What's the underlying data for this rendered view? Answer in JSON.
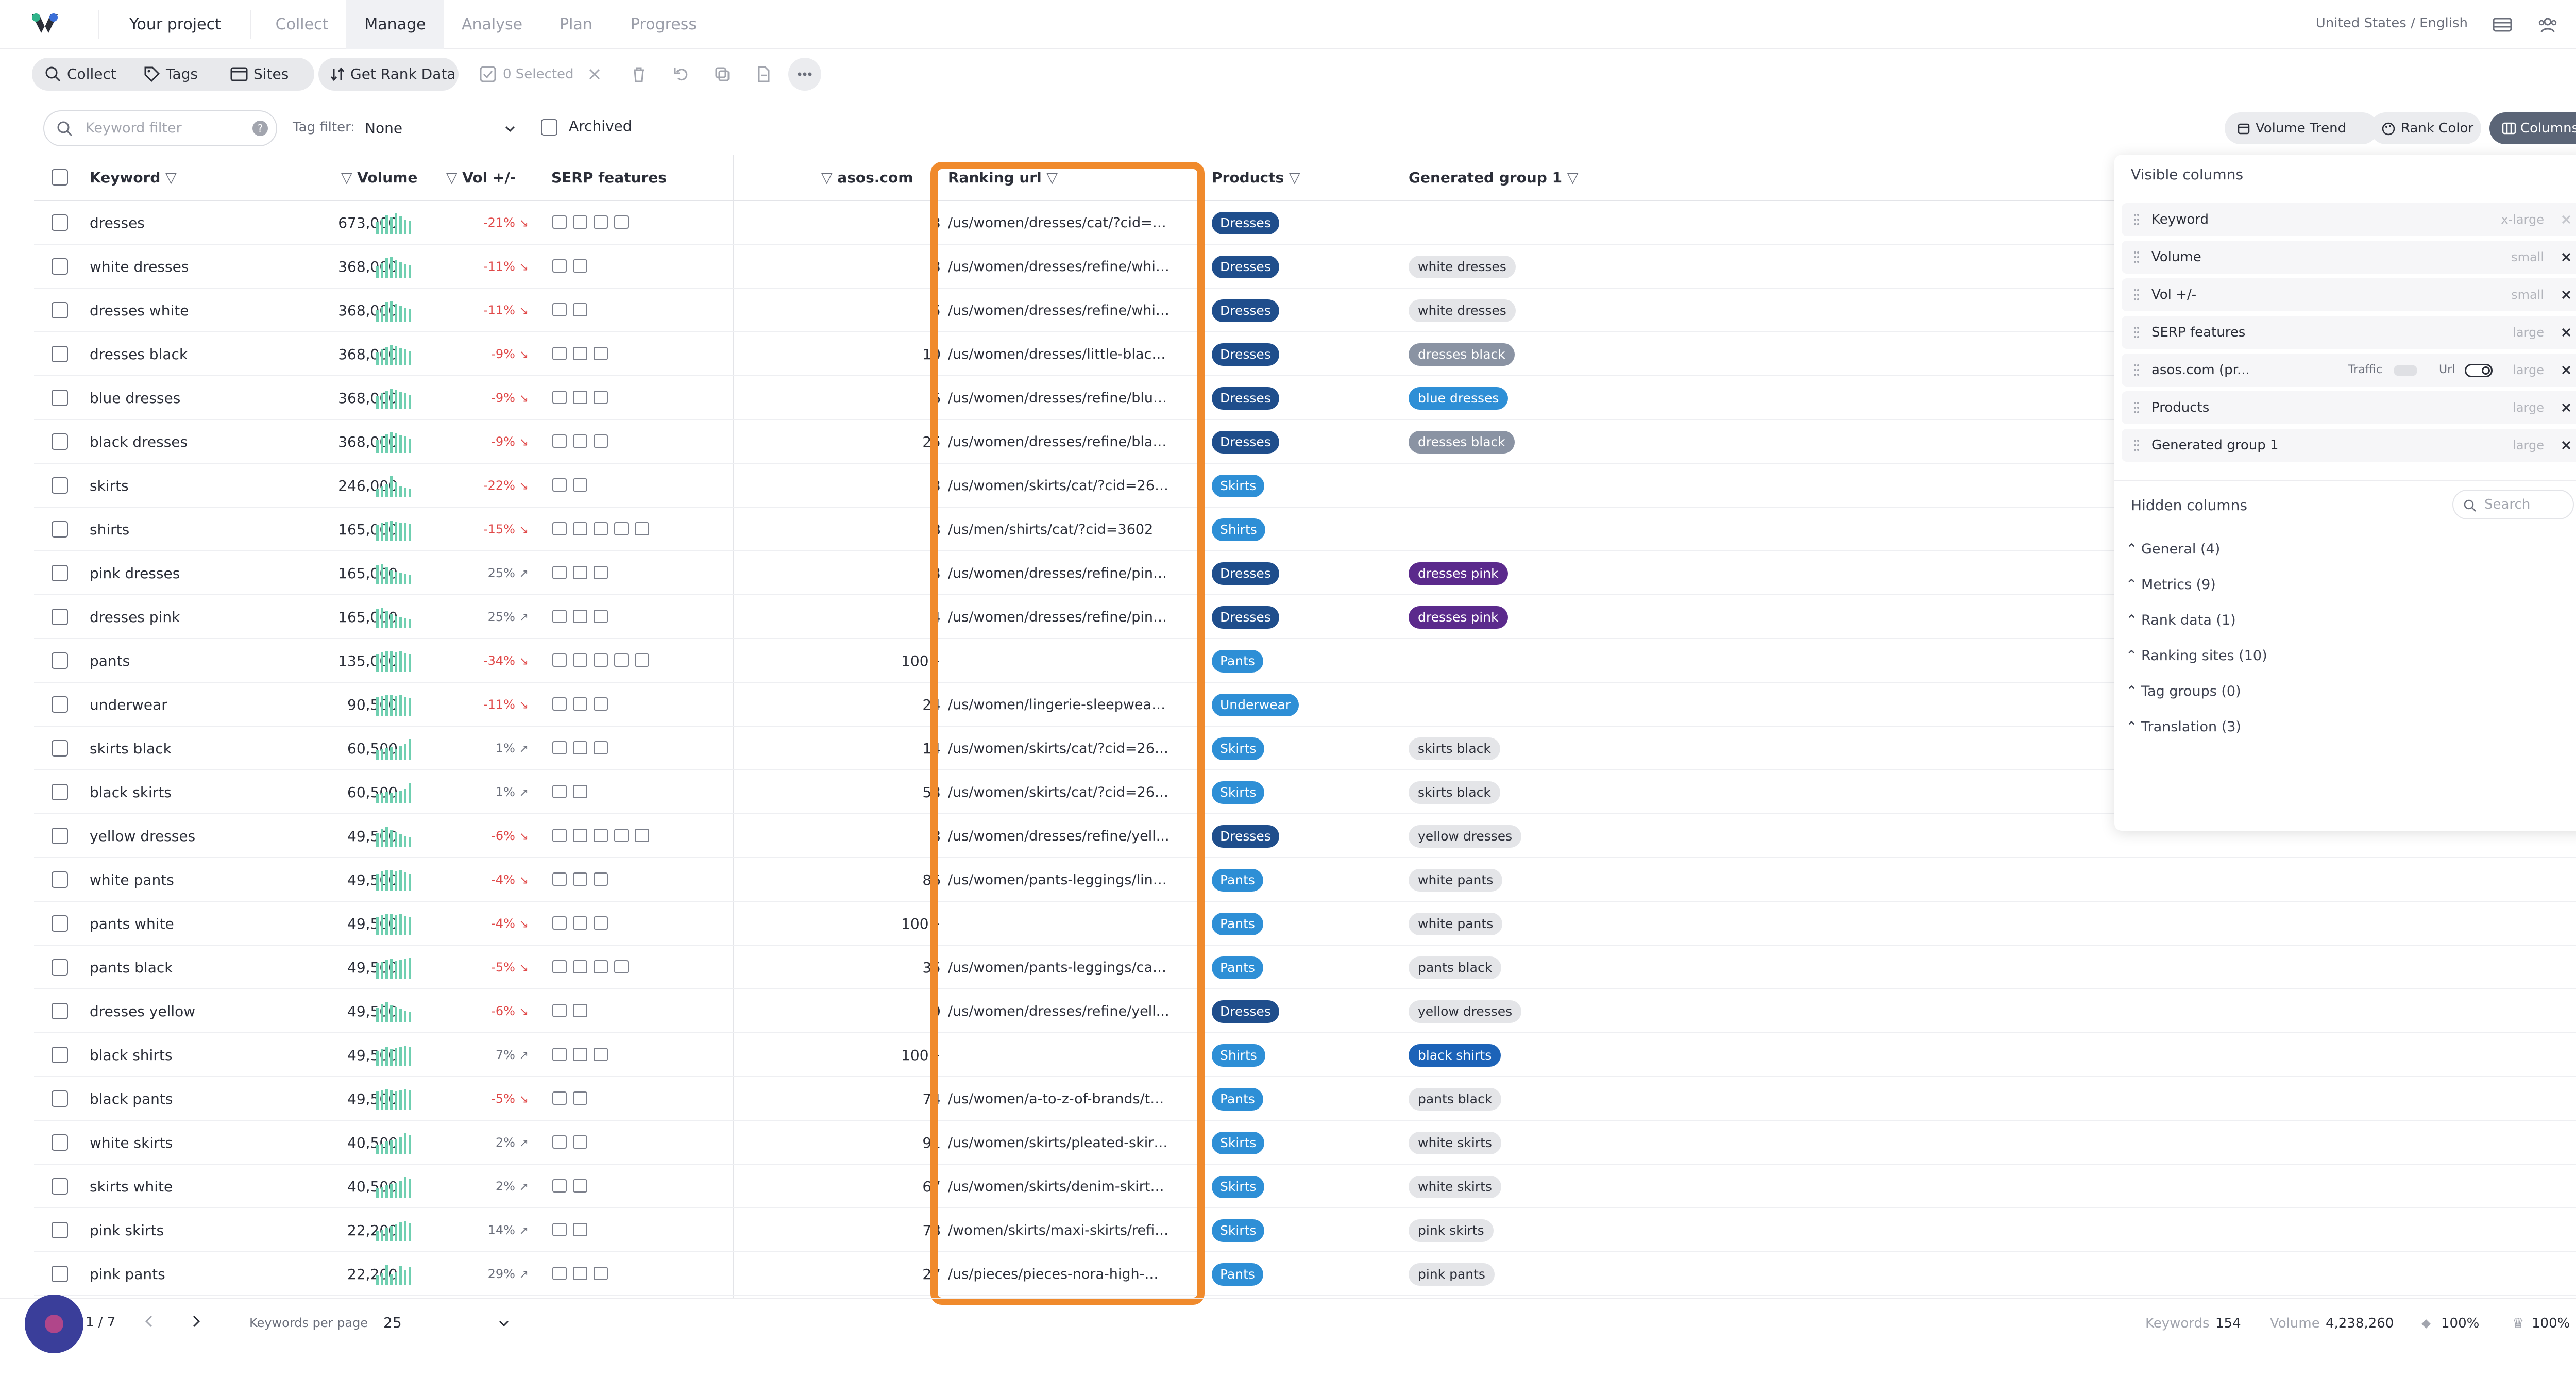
{
  "nav": {
    "project": "Your project",
    "tabs": [
      "Collect",
      "Manage",
      "Analyse",
      "Plan",
      "Progress"
    ],
    "active_tab": "Manage",
    "locale": "United States / English"
  },
  "toolbar": {
    "collect": "Collect",
    "tags": "Tags",
    "sites": "Sites",
    "get_rank": "Get Rank Data",
    "selected": "0 Selected"
  },
  "filters": {
    "keyword_placeholder": "Keyword filter",
    "help": "?",
    "tag_filter_label": "Tag filter:",
    "tag_filter_value": "None",
    "archived": "Archived",
    "volume_trend": "Volume Trend",
    "rank_color": "Rank Color",
    "columns": "Columns"
  },
  "headers": {
    "keyword": "Keyword",
    "volume": "Volume",
    "vol_change": "Vol +/-",
    "serp": "SERP features",
    "site": "asos.com",
    "ranking_url": "Ranking url",
    "products": "Products",
    "group": "Generated group 1"
  },
  "colors": {
    "dresses": "#1f4e8c",
    "skirts": "#2e8fd6",
    "shirts": "#2e8fd6",
    "pants": "#2e8fd6",
    "underwear": "#2e8fd6",
    "highlight": "#f08a2c"
  },
  "rows": [
    {
      "kw": "dresses",
      "vol": "673,000",
      "chg": "-21%",
      "dir": "down",
      "serp": 4,
      "rank": "3",
      "url": "/us/women/dresses/cat/?cid=8...",
      "prod": "Dresses",
      "group": "",
      "gstyle": "",
      "trend": [
        14,
        20,
        26,
        22,
        30,
        24,
        18,
        15
      ]
    },
    {
      "kw": "white dresses",
      "vol": "368,000",
      "chg": "-11%",
      "dir": "down",
      "serp": 2,
      "rank": "3",
      "url": "/us/women/dresses/refine/whit...",
      "prod": "Dresses",
      "group": "white dresses",
      "gstyle": "grey",
      "trend": [
        12,
        18,
        28,
        30,
        24,
        20,
        16,
        14
      ]
    },
    {
      "kw": "dresses white",
      "vol": "368,000",
      "chg": "-11%",
      "dir": "down",
      "serp": 2,
      "rank": "5",
      "url": "/us/women/dresses/refine/whit...",
      "prod": "Dresses",
      "group": "white dresses",
      "gstyle": "grey",
      "trend": [
        12,
        18,
        28,
        30,
        24,
        20,
        16,
        14
      ]
    },
    {
      "kw": "dresses black",
      "vol": "368,000",
      "chg": "-9%",
      "dir": "down",
      "serp": 3,
      "rank": "10",
      "url": "/us/women/dresses/little-black-...",
      "prod": "Dresses",
      "group": "dresses black",
      "gstyle": "slate",
      "trend": [
        16,
        22,
        26,
        30,
        28,
        24,
        22,
        18
      ]
    },
    {
      "kw": "blue dresses",
      "vol": "368,000",
      "chg": "-9%",
      "dir": "down",
      "serp": 3,
      "rank": "6",
      "url": "/us/women/dresses/refine/blue...",
      "prod": "Dresses",
      "group": "blue dresses",
      "gstyle": "blue",
      "trend": [
        16,
        22,
        26,
        30,
        28,
        24,
        22,
        18
      ]
    },
    {
      "kw": "black dresses",
      "vol": "368,000",
      "chg": "-9%",
      "dir": "down",
      "serp": 3,
      "rank": "25",
      "url": "/us/women/dresses/refine/blac...",
      "prod": "Dresses",
      "group": "dresses black",
      "gstyle": "slate",
      "trend": [
        16,
        22,
        26,
        30,
        28,
        24,
        22,
        18
      ]
    },
    {
      "kw": "skirts",
      "vol": "246,000",
      "chg": "-22%",
      "dir": "down",
      "serp": 2,
      "rank": "3",
      "url": "/us/women/skirts/cat/?cid=2639",
      "prod": "Skirts",
      "group": "",
      "gstyle": "",
      "trend": [
        6,
        10,
        14,
        30,
        18,
        10,
        8,
        6
      ]
    },
    {
      "kw": "shirts",
      "vol": "165,000",
      "chg": "-15%",
      "dir": "down",
      "serp": 5,
      "rank": "8",
      "url": "/us/men/shirts/cat/?cid=3602",
      "prod": "Shirts",
      "group": "",
      "gstyle": "",
      "trend": [
        20,
        24,
        26,
        28,
        26,
        24,
        24,
        22
      ]
    },
    {
      "kw": "pink dresses",
      "vol": "165,000",
      "chg": "25%",
      "dir": "up",
      "serp": 3,
      "rank": "3",
      "url": "/us/women/dresses/refine/pink...",
      "prod": "Dresses",
      "group": "dresses pink",
      "gstyle": "purple",
      "trend": [
        28,
        30,
        24,
        18,
        14,
        12,
        10,
        8
      ]
    },
    {
      "kw": "dresses pink",
      "vol": "165,000",
      "chg": "25%",
      "dir": "up",
      "serp": 3,
      "rank": "4",
      "url": "/us/women/dresses/refine/pink...",
      "prod": "Dresses",
      "group": "dresses pink",
      "gstyle": "purple",
      "trend": [
        28,
        30,
        24,
        18,
        14,
        12,
        10,
        8
      ]
    },
    {
      "kw": "pants",
      "vol": "135,000",
      "chg": "-34%",
      "dir": "down",
      "serp": 5,
      "rank": "100+",
      "url": "",
      "prod": "Pants",
      "group": "",
      "gstyle": "",
      "trend": [
        24,
        28,
        30,
        30,
        28,
        30,
        26,
        24
      ]
    },
    {
      "kw": "underwear",
      "vol": "90,500",
      "chg": "-11%",
      "dir": "down",
      "serp": 3,
      "rank": "24",
      "url": "/us/women/lingerie-sleepwear/...",
      "prod": "Underwear",
      "group": "",
      "gstyle": "",
      "trend": [
        26,
        28,
        30,
        30,
        28,
        30,
        26,
        24
      ]
    },
    {
      "kw": "skirts black",
      "vol": "60,500",
      "chg": "1%",
      "dir": "up",
      "serp": 3,
      "rank": "14",
      "url": "/us/women/skirts/cat/?cid=2639",
      "prod": "Skirts",
      "group": "skirts black",
      "gstyle": "grey",
      "trend": [
        8,
        10,
        12,
        14,
        10,
        16,
        20,
        30
      ]
    },
    {
      "kw": "black skirts",
      "vol": "60,500",
      "chg": "1%",
      "dir": "up",
      "serp": 2,
      "rank": "53",
      "url": "/us/women/skirts/cat/?cid=2639",
      "prod": "Skirts",
      "group": "skirts black",
      "gstyle": "grey",
      "trend": [
        8,
        10,
        12,
        10,
        12,
        14,
        18,
        30
      ]
    },
    {
      "kw": "yellow dresses",
      "vol": "49,500",
      "chg": "-6%",
      "dir": "down",
      "serp": 5,
      "rank": "8",
      "url": "/us/women/dresses/refine/yell...",
      "prod": "Dresses",
      "group": "yellow dresses",
      "gstyle": "grey",
      "trend": [
        18,
        26,
        30,
        24,
        20,
        16,
        12,
        10
      ]
    },
    {
      "kw": "white pants",
      "vol": "49,500",
      "chg": "-4%",
      "dir": "down",
      "serp": 3,
      "rank": "86",
      "url": "/us/women/pants-leggings/line...",
      "prod": "Pants",
      "group": "white pants",
      "gstyle": "grey",
      "trend": [
        24,
        28,
        30,
        30,
        28,
        30,
        26,
        24
      ]
    },
    {
      "kw": "pants white",
      "vol": "49,500",
      "chg": "-4%",
      "dir": "down",
      "serp": 3,
      "rank": "100+",
      "url": "",
      "prod": "Pants",
      "group": "white pants",
      "gstyle": "grey",
      "trend": [
        24,
        28,
        30,
        30,
        28,
        30,
        26,
        24
      ]
    },
    {
      "kw": "pants black",
      "vol": "49,500",
      "chg": "-5%",
      "dir": "down",
      "serp": 4,
      "rank": "35",
      "url": "/us/women/pants-leggings/cat/...",
      "prod": "Pants",
      "group": "pants black",
      "gstyle": "grey",
      "trend": [
        20,
        22,
        26,
        28,
        24,
        26,
        28,
        30
      ]
    },
    {
      "kw": "dresses yellow",
      "vol": "49,500",
      "chg": "-6%",
      "dir": "down",
      "serp": 2,
      "rank": "9",
      "url": "/us/women/dresses/refine/yell...",
      "prod": "Dresses",
      "group": "yellow dresses",
      "gstyle": "grey",
      "trend": [
        18,
        26,
        30,
        24,
        20,
        16,
        12,
        10
      ]
    },
    {
      "kw": "black shirts",
      "vol": "49,500",
      "chg": "7%",
      "dir": "up",
      "serp": 3,
      "rank": "100+",
      "url": "",
      "prod": "Shirts",
      "group": "black shirts",
      "gstyle": "navy",
      "trend": [
        20,
        24,
        28,
        24,
        26,
        28,
        30,
        28
      ]
    },
    {
      "kw": "black pants",
      "vol": "49,500",
      "chg": "-5%",
      "dir": "down",
      "serp": 2,
      "rank": "74",
      "url": "/us/women/a-to-z-of-brands/to...",
      "prod": "Pants",
      "group": "pants black",
      "gstyle": "grey",
      "trend": [
        26,
        28,
        30,
        28,
        26,
        28,
        30,
        28
      ]
    },
    {
      "kw": "white skirts",
      "vol": "40,500",
      "chg": "2%",
      "dir": "up",
      "serp": 2,
      "rank": "91",
      "url": "/us/women/skirts/pleated-skirt...",
      "prod": "Skirts",
      "group": "white skirts",
      "gstyle": "grey",
      "trend": [
        8,
        10,
        14,
        16,
        18,
        22,
        30,
        26
      ]
    },
    {
      "kw": "skirts white",
      "vol": "40,500",
      "chg": "2%",
      "dir": "up",
      "serp": 2,
      "rank": "67",
      "url": "/us/women/skirts/denim-skirts/...",
      "prod": "Skirts",
      "group": "white skirts",
      "gstyle": "grey",
      "trend": [
        8,
        10,
        14,
        16,
        18,
        22,
        30,
        26
      ]
    },
    {
      "kw": "pink skirts",
      "vol": "22,200",
      "chg": "14%",
      "dir": "up",
      "serp": 2,
      "rank": "78",
      "url": "/women/skirts/maxi-skirts/refin...",
      "prod": "Skirts",
      "group": "pink skirts",
      "gstyle": "grey",
      "trend": [
        10,
        12,
        16,
        20,
        24,
        28,
        30,
        26
      ]
    },
    {
      "kw": "pink pants",
      "vol": "22,200",
      "chg": "29%",
      "dir": "up",
      "serp": 3,
      "rank": "27",
      "url": "/us/pieces/pieces-nora-high-wai...",
      "prod": "Pants",
      "group": "pink pants",
      "gstyle": "grey",
      "trend": [
        10,
        14,
        30,
        12,
        16,
        28,
        20,
        26
      ]
    }
  ],
  "panel": {
    "visible_title": "Visible columns",
    "visible": [
      {
        "name": "Keyword",
        "size": "x-large",
        "removable": false
      },
      {
        "name": "Volume",
        "size": "small",
        "removable": true
      },
      {
        "name": "Vol +/-",
        "size": "small",
        "removable": true
      },
      {
        "name": "SERP features",
        "size": "large",
        "removable": true
      },
      {
        "name": "asos.com (pr...",
        "size": "large",
        "removable": true,
        "traffic": "Traffic",
        "url": "Url"
      },
      {
        "name": "Products",
        "size": "large",
        "removable": true
      },
      {
        "name": "Generated group 1",
        "size": "large",
        "removable": true
      }
    ],
    "hidden_title": "Hidden columns",
    "search_placeholder": "Search",
    "hidden": [
      "General (4)",
      "Metrics (9)",
      "Rank data (1)",
      "Ranking sites (10)",
      "Tag groups (0)",
      "Translation (3)"
    ]
  },
  "footer": {
    "page": "1 / 7",
    "per_page_label": "Keywords per page",
    "per_page": "25",
    "keywords_label": "Keywords",
    "keywords": "154",
    "volume_label": "Volume",
    "volume": "4,238,260",
    "pct1": "100%",
    "pct2": "100%"
  }
}
